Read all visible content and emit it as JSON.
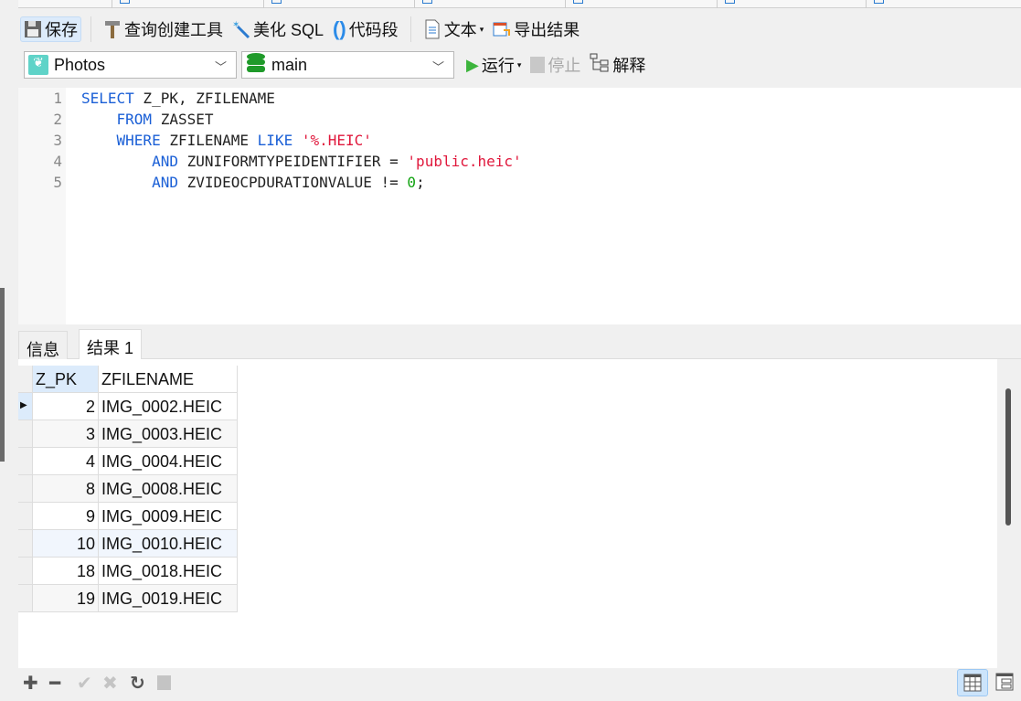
{
  "toolbar1": {
    "save": "保存",
    "query_builder": "查询创建工具",
    "beautify": "美化 SQL",
    "snippet": "代码段",
    "text": "文本",
    "export": "导出结果"
  },
  "toolbar2": {
    "connection": "Photos",
    "database": "main",
    "run": "运行",
    "stop": "停止",
    "explain": "解释"
  },
  "editor": {
    "line_numbers": [
      "1",
      "2",
      "3",
      "4",
      "5"
    ],
    "lines": [
      [
        {
          "t": "SELECT",
          "c": "kw"
        },
        {
          "t": " Z_PK, ZFILENAME",
          "c": ""
        }
      ],
      [
        {
          "t": "    ",
          "c": ""
        },
        {
          "t": "FROM",
          "c": "kw"
        },
        {
          "t": " ZASSET",
          "c": ""
        }
      ],
      [
        {
          "t": "    ",
          "c": ""
        },
        {
          "t": "WHERE",
          "c": "kw"
        },
        {
          "t": " ZFILENAME ",
          "c": ""
        },
        {
          "t": "LIKE",
          "c": "kw"
        },
        {
          "t": " ",
          "c": ""
        },
        {
          "t": "'%.HEIC'",
          "c": "str"
        }
      ],
      [
        {
          "t": "        ",
          "c": ""
        },
        {
          "t": "AND",
          "c": "kw"
        },
        {
          "t": " ZUNIFORMTYPEIDENTIFIER = ",
          "c": ""
        },
        {
          "t": "'public.heic'",
          "c": "str"
        }
      ],
      [
        {
          "t": "        ",
          "c": ""
        },
        {
          "t": "AND",
          "c": "kw"
        },
        {
          "t": " ZVIDEOCPDURATIONVALUE != ",
          "c": ""
        },
        {
          "t": "0",
          "c": "num"
        },
        {
          "t": ";",
          "c": ""
        }
      ]
    ]
  },
  "result_tabs": [
    {
      "label": "信息"
    },
    {
      "label": "结果 1"
    }
  ],
  "grid": {
    "columns": [
      "Z_PK",
      "ZFILENAME"
    ],
    "rows": [
      [
        "2",
        "IMG_0002.HEIC"
      ],
      [
        "3",
        "IMG_0003.HEIC"
      ],
      [
        "4",
        "IMG_0004.HEIC"
      ],
      [
        "8",
        "IMG_0008.HEIC"
      ],
      [
        "9",
        "IMG_0009.HEIC"
      ],
      [
        "10",
        "IMG_0010.HEIC"
      ],
      [
        "18",
        "IMG_0018.HEIC"
      ],
      [
        "19",
        "IMG_0019.HEIC"
      ]
    ]
  },
  "colors": {
    "keyword": "#1a5fd6",
    "string": "#e0183c",
    "number": "#12a312",
    "run": "#3cb43c",
    "db": "#1f9a2a"
  }
}
